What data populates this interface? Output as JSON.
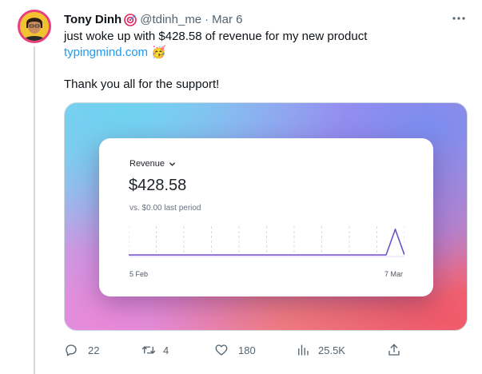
{
  "author": {
    "name": "Tony Dinh",
    "handle": "@tdinh_me",
    "separator": "·",
    "date": "Mar 6",
    "badge_icon": "target-icon"
  },
  "tweet": {
    "line1": "just woke up with $428.58 of revenue for my new product",
    "link": "typingmind.com",
    "emoji": "🥳",
    "line2": "Thank you all for the support!"
  },
  "card": {
    "label": "Revenue",
    "amount": "$428.58",
    "compare": "vs. $0.00 last period",
    "axis_start": "5 Feb",
    "axis_end": "7 Mar"
  },
  "chart_data": {
    "type": "line",
    "title": "Revenue",
    "x_range": [
      "5 Feb",
      "7 Mar"
    ],
    "series": [
      {
        "values": [
          0,
          0,
          0,
          0,
          0,
          0,
          0,
          0,
          0,
          0,
          0,
          0,
          0,
          0,
          0,
          0,
          0,
          0,
          0,
          0,
          0,
          0,
          0,
          0,
          0,
          0,
          0,
          0,
          0,
          428.58,
          0
        ]
      }
    ],
    "line_color": "#6f4fc8",
    "grid": "dashed-vertical"
  },
  "actions": {
    "replies": "22",
    "reposts": "4",
    "likes": "180",
    "views": "25.5K"
  },
  "colors": {
    "link": "#1d9bf0",
    "muted": "#536471",
    "thread_line": "#cfd9de",
    "avatar_ring": "#e8407f"
  }
}
